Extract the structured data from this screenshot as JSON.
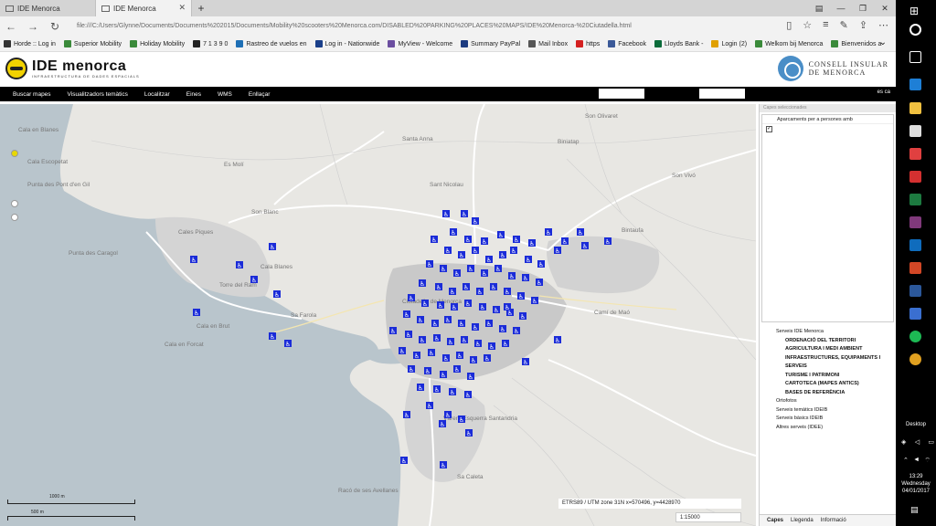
{
  "browser": {
    "tabs": [
      {
        "title": "IDE Menorca",
        "active": false
      },
      {
        "title": "IDE Menorca",
        "active": true
      }
    ],
    "new_tab": "+",
    "address": "file:///C:/Users/Glynne/Documents/Documents%202015/Documents/Mobility%20scooters%20Menorca.com/DISABLED%20PARKING%20PLACES%20MAPS/IDE%20Menorca-%20Ciutadella.html",
    "favorites": [
      {
        "label": "Horde :: Log in",
        "color": "#333333"
      },
      {
        "label": "Superior Mobility",
        "color": "#3a8a3a"
      },
      {
        "label": "Holiday Mobility",
        "color": "#3a8a3a"
      },
      {
        "label": "7 1 3 9 0",
        "color": "#222222"
      },
      {
        "label": "Rastreo de vuelos en",
        "color": "#1e6fb5"
      },
      {
        "label": "Log in - Nationwide",
        "color": "#1a3f8a"
      },
      {
        "label": "MyView - Welcome",
        "color": "#6b4ea0"
      },
      {
        "label": "Summary PayPal",
        "color": "#1c3b80"
      },
      {
        "label": "Mail Inbox",
        "color": "#555555"
      },
      {
        "label": "https",
        "color": "#d42020"
      },
      {
        "label": "Facebook",
        "color": "#3b5998"
      },
      {
        "label": "Lloyds Bank -",
        "color": "#0a6b3a"
      },
      {
        "label": "Login (2)",
        "color": "#e0a000"
      },
      {
        "label": "Welkom bij Menorca",
        "color": "#3a8a3a"
      },
      {
        "label": "Bienvenidos a",
        "color": "#3a8a3a"
      }
    ]
  },
  "site": {
    "logo_title": "IDE menorca",
    "logo_subtitle": "INFRAESTRUCTURA DE DADES ESPACIALS",
    "council_line1": "CONSELL INSULAR",
    "council_line2": "DE MENORCA",
    "menu": [
      "Buscar mapes",
      "Visualitzadors temàtics",
      "Localitzar",
      "Eines",
      "WMS",
      "Enllaçar"
    ],
    "languages": "es  ca"
  },
  "map": {
    "place_labels": [
      "Cala en Blanes",
      "Cala Escopetat",
      "Punta des Pont d'en Gil",
      "Cales Piques",
      "Punta des Caragol",
      "Cala en Forcat",
      "Torre del Ram",
      "Cala Blanes",
      "Cala en Brut",
      "Sa Farola",
      "Ciutadella de Menorca",
      "Son Blanc",
      "Vàrera Esquerra Santandria",
      "Sa Caleta",
      "Racó de ses Avellanes",
      "Son Olivaret",
      "Biniatap",
      "Es Molí",
      "Santa Anna",
      "Sant Nicolau",
      "Son Vivó",
      "Camí de Maó",
      "Bintaufa"
    ],
    "coords_text": "ETRS89 / UTM zone 31N   x=570496, y=4428970",
    "scale_value": "1:15000",
    "scale_bar_1": "1000 m",
    "scale_bar_2": "500 m",
    "parking_count": 104
  },
  "panel": {
    "header": "Capes seleccionades",
    "layer": "Aparcaments per a persones amb",
    "tree": {
      "root": "Serveis IDE Menorca",
      "sub": [
        "ORDENACIÓ DEL TERRITORI",
        "AGRICULTURA I MEDI AMBIENT",
        "INFRAESTRUCTURES, EQUIPAMENTS I SERVEIS",
        "TURISME I PATRIMONI",
        "CARTOTECA (MAPES ANTICS)",
        "BASES DE REFERÈNCIA"
      ],
      "others": [
        "Ortofotos",
        "Serveis temàtics IDEIB",
        "Serveis bàsics IDEIB",
        "Altres serveis (IDEE)"
      ]
    },
    "tabs": [
      "Capes",
      "Llegenda",
      "Informació"
    ]
  },
  "taskbar": {
    "desktop_label": "Desktop",
    "time": "13:29",
    "day": "Wednesday",
    "date": "04/01/2017"
  },
  "colors": {
    "parking_blue": "#1a2bd8",
    "sea": "#b9c5cc",
    "land": "#e8e7e3",
    "town": "#c9c9c9"
  }
}
